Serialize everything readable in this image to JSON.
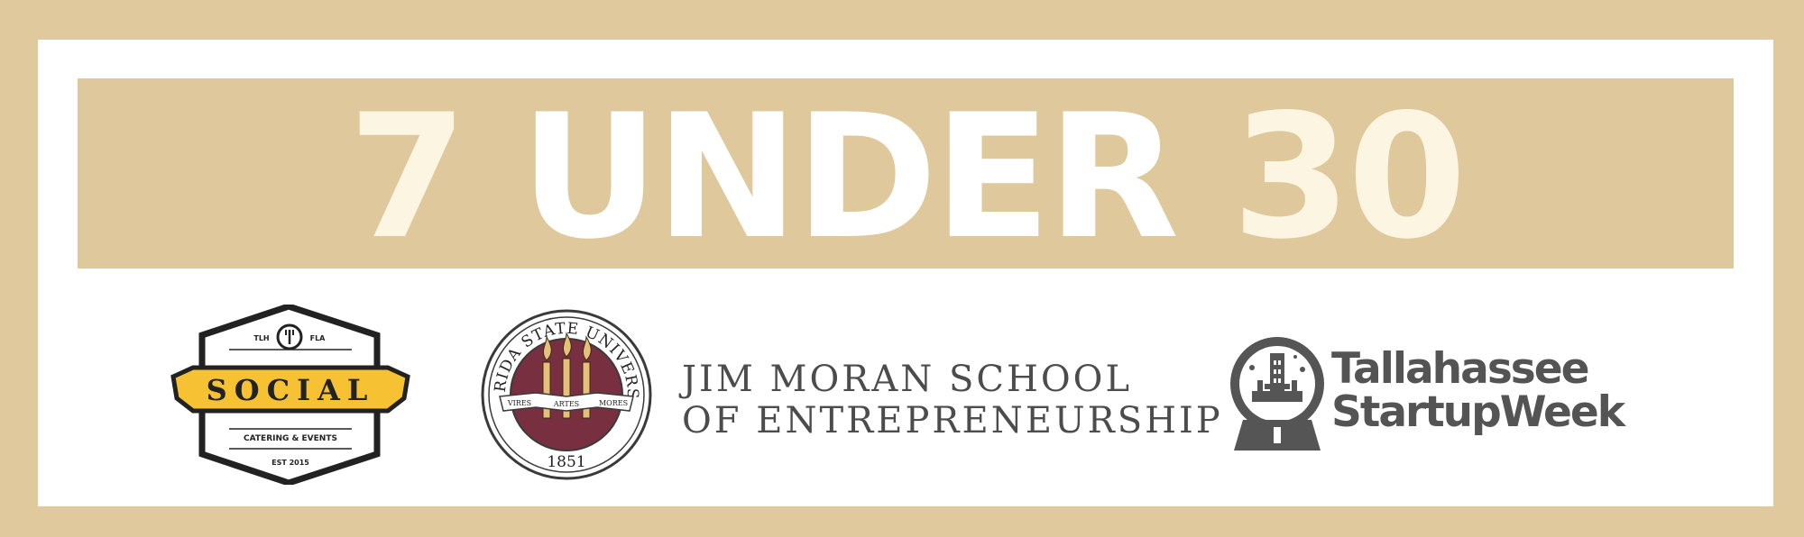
{
  "headline": {
    "part1": "7",
    "part2": "UNDER",
    "part3": "30"
  },
  "social_logo": {
    "top_left": "TLH",
    "top_right": "FLA",
    "name": "SOCIAL",
    "tagline": "CATERING & EVENTS",
    "established": "EST 2015"
  },
  "fsu_seal": {
    "arc_text": "FLORIDA STATE UNIVERSITY",
    "ribbon": [
      "VIRES",
      "ARTES",
      "MORES"
    ],
    "year": "1851"
  },
  "jim_moran": {
    "line1": "JIM MORAN SCHOOL",
    "line2": "OF ENTREPRENEURSHIP"
  },
  "tsw": {
    "line1": "Tallahassee",
    "line2": "StartupWeek"
  },
  "colors": {
    "gold": "#dfc99c",
    "cream": "#fbf5e2",
    "garnet": "#782f40",
    "social_yellow": "#f6c234",
    "gray_text": "#4c4c4c"
  }
}
